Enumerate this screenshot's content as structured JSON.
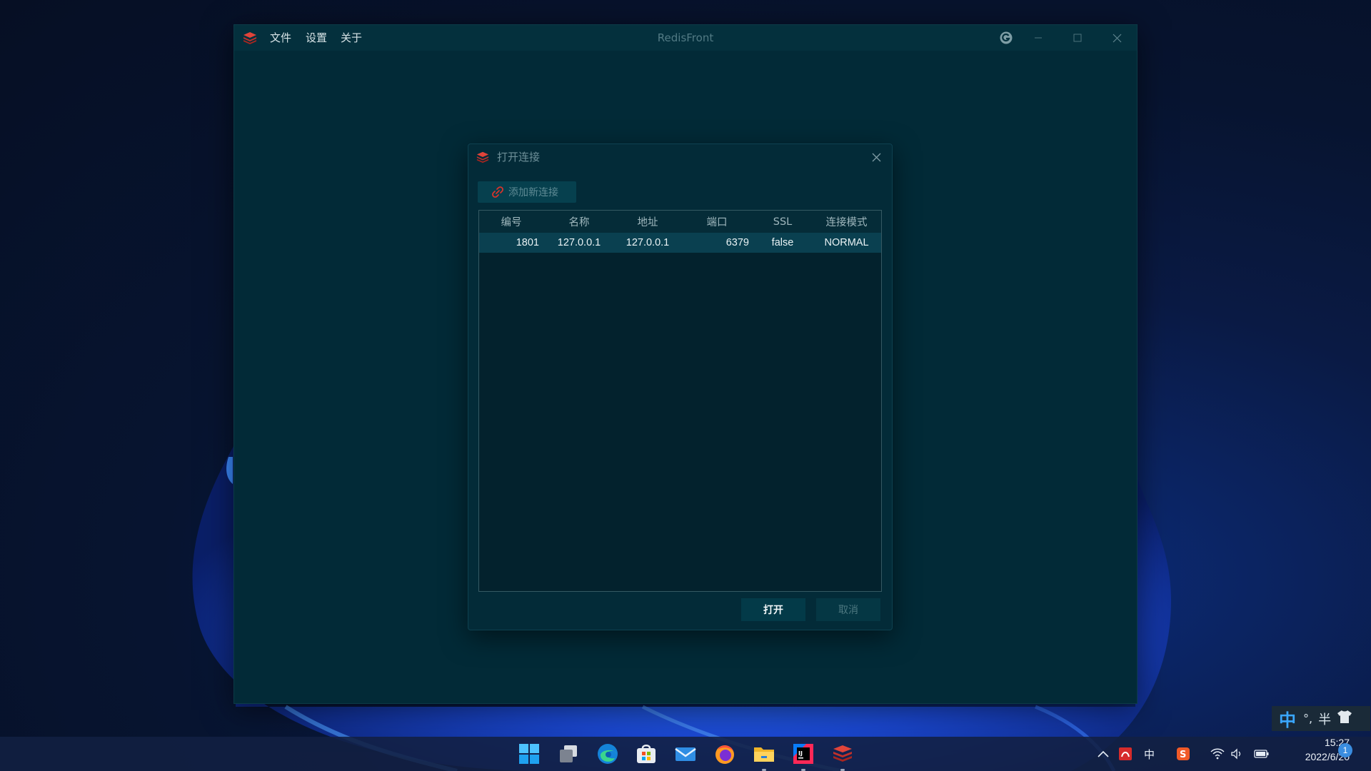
{
  "app": {
    "title": "RedisFront",
    "menu": [
      "文件",
      "设置",
      "关于"
    ]
  },
  "dialog": {
    "title": "打开连接",
    "add_button": "添加新连接",
    "columns": [
      "编号",
      "名称",
      "地址",
      "端口",
      "SSL",
      "连接模式"
    ],
    "rows": [
      [
        "1801",
        "127.0.0.1",
        "127.0.0.1",
        "6379",
        "false",
        "NORMAL"
      ]
    ],
    "open_button": "打开",
    "cancel_button": "取消"
  },
  "ime": {
    "mode": "中",
    "punct": "°,",
    "width": "半"
  },
  "taskbar": {
    "apps": [
      "windows-start",
      "task-view",
      "edge",
      "microsoft-store",
      "mail",
      "firefox",
      "file-explorer",
      "intellij-idea",
      "redisfront"
    ],
    "tray_ime": "中",
    "time": "15:27",
    "date": "2022/6/20",
    "notifications": "1"
  },
  "colors": {
    "window_bg": "#022a37",
    "accent_red": "#d9332b"
  }
}
